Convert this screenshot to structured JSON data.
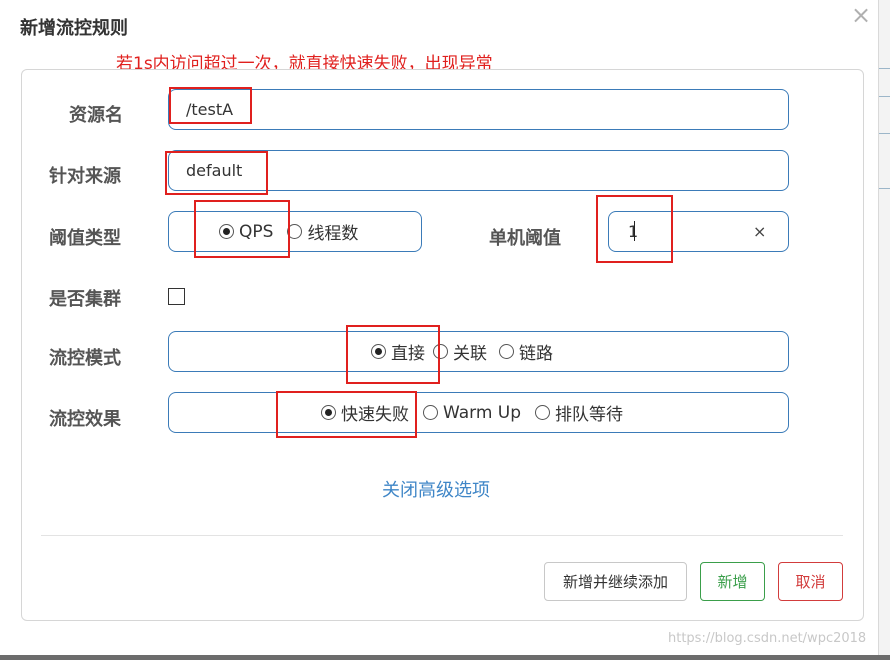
{
  "dialog": {
    "title": "新增流控规则",
    "annotation": "若1s内访问超过一次，就直接快速失败，出现异常"
  },
  "form": {
    "resource": {
      "label": "资源名",
      "value": "/testA"
    },
    "source": {
      "label": "针对来源",
      "value": "default"
    },
    "threshold_type": {
      "label": "阈值类型",
      "options": [
        "QPS",
        "线程数"
      ],
      "selected": "QPS"
    },
    "single_threshold": {
      "label": "单机阈值",
      "value": "1",
      "clear": "×"
    },
    "cluster": {
      "label": "是否集群",
      "checked": false
    },
    "control_mode": {
      "label": "流控模式",
      "options": [
        "直接",
        "关联",
        "链路"
      ],
      "selected": "直接"
    },
    "control_effect": {
      "label": "流控效果",
      "options": [
        "快速失败",
        "Warm Up",
        "排队等待"
      ],
      "selected": "快速失败"
    },
    "advanced_link": "关闭高级选项"
  },
  "buttons": {
    "add_continue": "新增并继续添加",
    "add": "新增",
    "cancel": "取消"
  },
  "watermark": "https://blog.csdn.net/wpc2018",
  "colors": {
    "annotation_red": "#e0201e",
    "field_border": "#3b7bb8",
    "link_blue": "#3f86c7",
    "add_green": "#3a9e4a",
    "cancel_red": "#d23c3c"
  }
}
